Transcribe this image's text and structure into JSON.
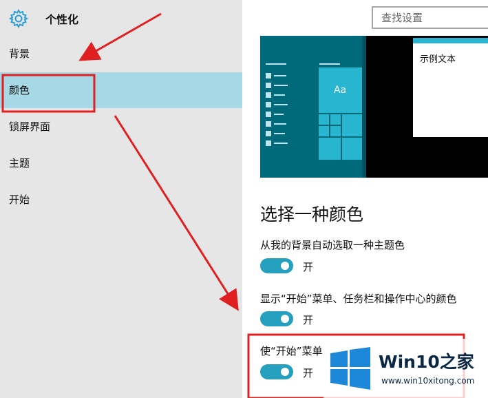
{
  "app": {
    "title": "个性化"
  },
  "search": {
    "placeholder": "查找设置"
  },
  "nav": {
    "items": [
      {
        "label": "背景",
        "selected": false
      },
      {
        "label": "颜色",
        "selected": true
      },
      {
        "label": "锁屏界面",
        "selected": false
      },
      {
        "label": "主题",
        "selected": false
      },
      {
        "label": "开始",
        "selected": false
      }
    ]
  },
  "preview": {
    "sample_text": "示例文本",
    "tile_label": "Aa"
  },
  "section": {
    "title": "选择一种颜色",
    "settings": [
      {
        "label": "从我的背景自动选取一种主题色",
        "state": "开"
      },
      {
        "label": "显示“开始”菜单、任务栏和操作中心的颜色",
        "state": "开"
      },
      {
        "label": "使“开始”菜单",
        "state": "开"
      }
    ]
  },
  "watermark": {
    "brand": "Win10之家",
    "url": "www.win10xitong.com"
  },
  "colors": {
    "accent": "#26a0bf",
    "selection": "#a7d8e6",
    "annotation": "#e02020",
    "preview_taskbar": "#006a7a"
  }
}
